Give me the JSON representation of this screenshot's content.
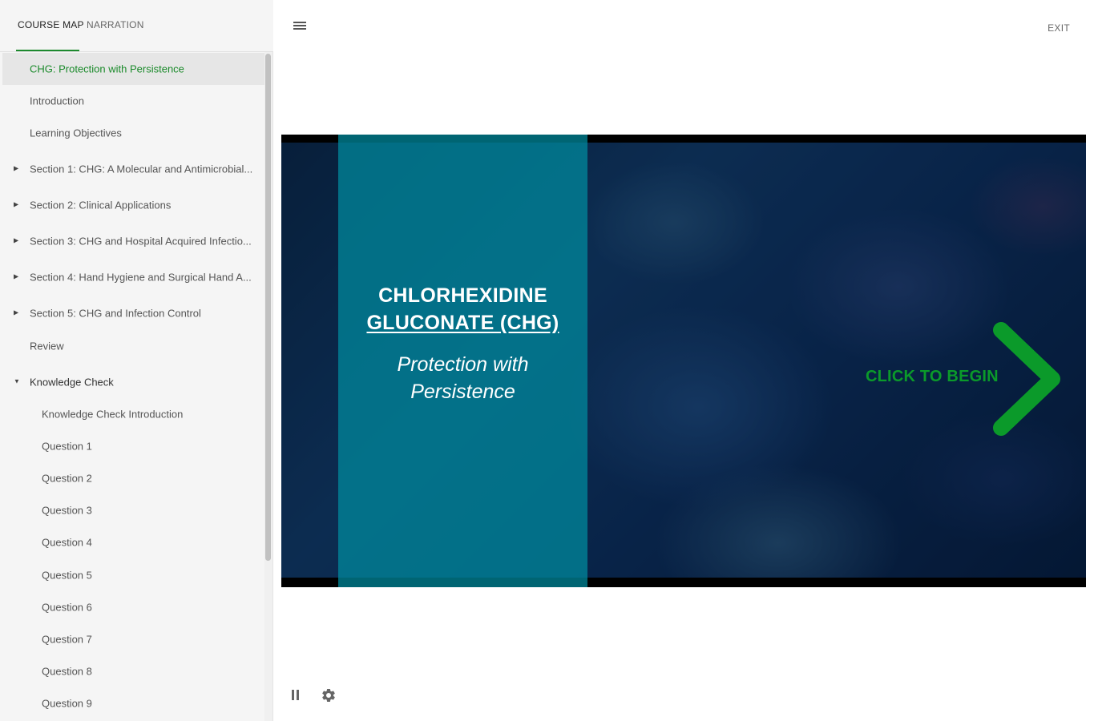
{
  "sidebar": {
    "tabs": [
      {
        "label": "COURSE MAP"
      },
      {
        "label": "NARRATION"
      }
    ],
    "items": [
      {
        "label": "CHG: Protection with Persistence"
      },
      {
        "label": "Introduction"
      },
      {
        "label": "Learning Objectives"
      },
      {
        "label": "Section 1: CHG: A Molecular and Antimicrobial..."
      },
      {
        "label": "Section 2: Clinical Applications"
      },
      {
        "label": "Section 3: CHG and Hospital Acquired Infectio..."
      },
      {
        "label": "Section 4: Hand Hygiene and Surgical Hand A..."
      },
      {
        "label": "Section 5: CHG and Infection Control"
      },
      {
        "label": "Review"
      },
      {
        "label": "Knowledge Check"
      },
      {
        "label": "Knowledge Check Introduction"
      },
      {
        "label": "Question 1"
      },
      {
        "label": "Question 2"
      },
      {
        "label": "Question 3"
      },
      {
        "label": "Question 4"
      },
      {
        "label": "Question 5"
      },
      {
        "label": "Question 6"
      },
      {
        "label": "Question 7"
      },
      {
        "label": "Question 8"
      },
      {
        "label": "Question 9"
      }
    ]
  },
  "header": {
    "exit_label": "EXIT"
  },
  "slide": {
    "title_line1": "CHLORHEXIDINE",
    "title_line2": "GLUCONATE (CHG)",
    "subtitle_line1": "Protection with",
    "subtitle_line2": "Persistence",
    "cta_label": "CLICK TO BEGIN"
  },
  "colors": {
    "accent_green": "#1a8a2a",
    "cta_green": "#0b9a2a",
    "panel_teal": "#008ca0"
  },
  "icons": {
    "menu": "hamburger-icon",
    "pause": "pause-icon",
    "settings": "gear-icon",
    "arrow": "chevron-right-icon",
    "caret_collapsed": "caret-right-icon",
    "caret_expanded": "caret-down-icon"
  }
}
